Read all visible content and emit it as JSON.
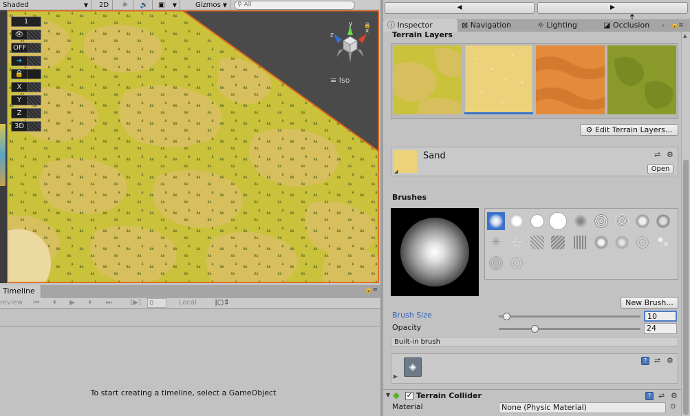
{
  "scene": {
    "toolbar": {
      "shading_mode": "Shaded",
      "mode_2d": "2D",
      "gizmos_label": "Gizmos",
      "search_placeholder": "All"
    },
    "overlay": {
      "layer_value": "1",
      "off_label": "OFF",
      "x_label": "X",
      "y_label": "Y",
      "z_label": "Z",
      "mode_3d": "3D"
    },
    "gizmo": {
      "x": "x",
      "y": "y",
      "z": "z"
    },
    "projection_label": "Iso"
  },
  "timeline": {
    "tab_label": "Timeline",
    "preview_label": "review",
    "frame_value": "0",
    "time_mode": "Local",
    "empty_message": "To start creating a timeline, select a GameObject"
  },
  "right_panel": {
    "nav_back": "◀",
    "nav_forward": "▶",
    "tabs": [
      {
        "label": "Inspector",
        "icon": "info-icon"
      },
      {
        "label": "Navigation",
        "icon": "navigation-icon"
      },
      {
        "label": "Lighting",
        "icon": "lighting-icon"
      },
      {
        "label": "Occlusion",
        "icon": "occlusion-icon"
      }
    ]
  },
  "inspector": {
    "terrain_layers_heading": "Terrain Layers",
    "edit_layers_button": "Edit Terrain Layers...",
    "selected_layer": {
      "name": "Sand",
      "open_button": "Open"
    },
    "brushes_heading": "Brushes",
    "new_brush_button": "New Brush...",
    "brush_size": {
      "label": "Brush Size",
      "value": "10",
      "fraction": 0.03
    },
    "opacity": {
      "label": "Opacity",
      "value": "24",
      "fraction": 0.24
    },
    "builtin_label": "Built-in brush",
    "terrain_collider": {
      "title": "Terrain Collider",
      "material_label": "Material",
      "material_value": "None (Physic Material)"
    }
  },
  "colors": {
    "accent": "#3a72c9",
    "terrain_border": "#e0651f",
    "grass_yellow": "#c9c23a",
    "sand": "#ecd27b"
  }
}
